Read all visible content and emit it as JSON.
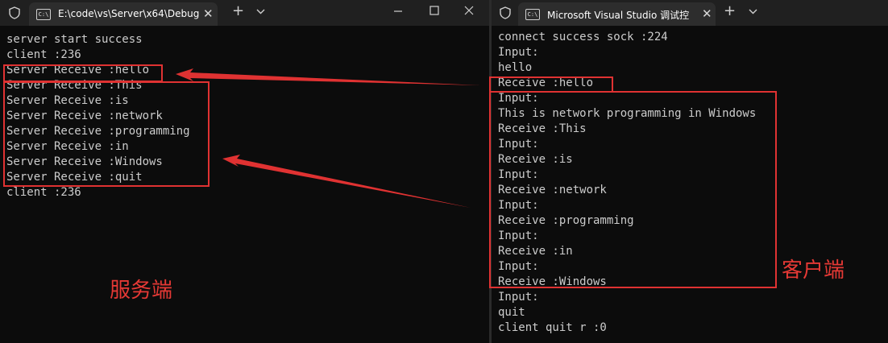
{
  "left_window": {
    "tab_title": "E:\\code\\vs\\Server\\x64\\Debug",
    "tab_icon": "C:\\",
    "lines": [
      "server start success",
      "client :236",
      "Server Receive :hello",
      "Server Receive :This",
      "Server Receive :is",
      "Server Receive :network",
      "Server Receive :programming",
      "Server Receive :in",
      "Server Receive :Windows",
      "Server Receive :quit",
      "client :236"
    ]
  },
  "right_window": {
    "tab_title": "Microsoft Visual Studio 调试控",
    "tab_icon": "C:\\",
    "lines": [
      "connect success sock :224",
      "Input:",
      "hello",
      "Receive :hello",
      "Input:",
      "This is network programming in Windows",
      "Receive :This",
      "Input:",
      "Receive :is",
      "Input:",
      "Receive :network",
      "Input:",
      "Receive :programming",
      "Input:",
      "Receive :in",
      "Input:",
      "Receive :Windows",
      "Input:",
      "quit",
      "client quit r :0"
    ]
  },
  "annotations": {
    "server_label": "服务端",
    "client_label": "客户端"
  },
  "colors": {
    "annotation_red": "#e03232",
    "terminal_text": "#cccccc",
    "terminal_bg": "#0c0c0c",
    "titlebar_bg": "#202020",
    "tab_bg": "#2d2d2d"
  },
  "icons": {
    "titlebar_left": "shield-icon",
    "tab": "terminal-icon",
    "new_tab": "plus-icon",
    "tab_menu": "chevron-down-icon",
    "minimize": "minimize-icon",
    "maximize": "maximize-icon",
    "close": "close-icon"
  }
}
